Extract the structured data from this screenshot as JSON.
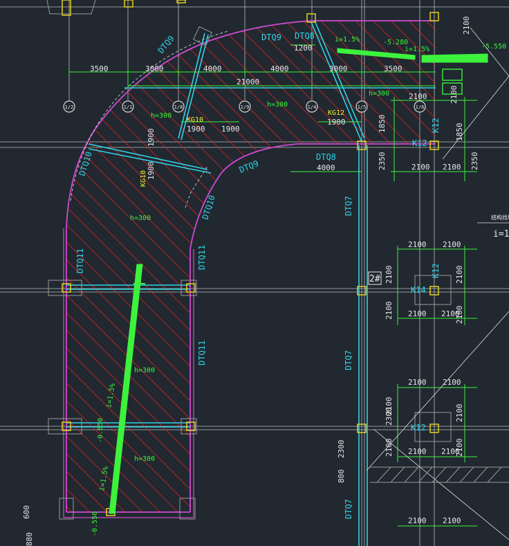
{
  "colors": {
    "background": "#212830",
    "hatch": "#e02020",
    "outline": "#d14ad1",
    "beam": "#2fd3e6",
    "dimension": "#e8e8e8",
    "slope_arrow": "#3df23d",
    "column": "#e6d020",
    "axis_line": "#d8d8d8"
  },
  "dims": {
    "top": [
      "3500",
      "3000",
      "4000",
      "4000",
      "3000",
      "3500"
    ],
    "total_top": "21000",
    "d1200": "1200",
    "d4000": "4000",
    "d1900_a": "1900",
    "d1900_b": "1900",
    "d1900_c": "1900",
    "d1900_d": "1900",
    "d1900_e": "1900",
    "d2100_top": "2100",
    "d1850": "1850",
    "d2350": "2350",
    "d2300": "2300",
    "d800": "800",
    "d600": "600",
    "d880": "880"
  },
  "axes": [
    "1/2",
    "1/1",
    "1/8",
    "1/9",
    "1/4",
    "1/5",
    "1/6"
  ],
  "beams": {
    "dtq9_a": "DTQ9",
    "dtq9_b": "DTQ9",
    "dtq9_c": "DTQ9",
    "dtq8_a": "DTQ8",
    "dtq8_b": "DTQ8",
    "dtq10_a": "DTQ10",
    "dtq10_b": "DTQ10",
    "dtq11_a": "DTQ11",
    "dtq11_b": "DTQ11",
    "dtq11_c": "DTQ11",
    "dtq7_a": "DTQ7",
    "dtq7_b": "DTQ7",
    "dtq7_c": "DTQ7",
    "kg10_a": "KG10",
    "kg10_b": "KG10",
    "kg12": "KG12"
  },
  "slab": {
    "h1": "h=300",
    "h2": "h=300",
    "h3": "h=300",
    "h4": "h=300",
    "h5": "h=300",
    "h6": "h=300"
  },
  "slope": {
    "i15_a": "i=1.5%",
    "i15_b": "i=1.5%",
    "i15_c": "i=1.5%",
    "i15_d": "i=1.5%",
    "elev_5280": "-5.280",
    "elev_5550": "-5.550",
    "elev_0850": "-0.850",
    "elev_0550": "-0.550"
  },
  "columns": {
    "k12_a": "K12",
    "k12_b": "K12",
    "k12_c": "K12",
    "k14": "K14",
    "k12_d": "K12",
    "stair": "2#"
  },
  "right_detail": {
    "d2100_1": "2100",
    "d2100_2": "2100",
    "d2100_3": "2100",
    "d2100_4": "2100",
    "d2100_5": "2100",
    "d2100_6": "2100",
    "d2100_7": "2100",
    "d2100_8": "2100",
    "d2100_9": "2100",
    "d2100_10": "2100",
    "d2100_11": "2100",
    "d2100_12": "2100",
    "d2100_13": "2100",
    "d2100_14": "2100",
    "d2100_15": "2100",
    "d2100_16": "2100",
    "d2100_17": "2100",
    "d1850r": "1850",
    "d2350r": "2350",
    "d2100v_1": "2100",
    "d2100v_2": "2100",
    "d2100v_3": "2100",
    "d2100v_4": "2100",
    "d2100v_5": "2100",
    "d2300r": "2300",
    "note_i": "i=1",
    "note_small": "结构找坡"
  }
}
